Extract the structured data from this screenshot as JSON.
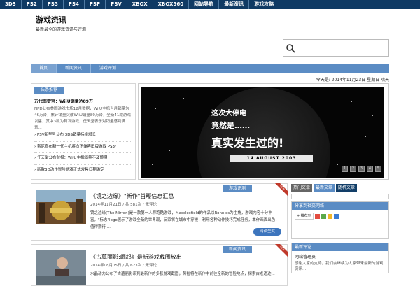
{
  "topnav": [
    "3DS",
    "PS2",
    "PS3",
    "PS4",
    "PSP",
    "PSV",
    "XBOX",
    "XBOX360",
    "网站导航",
    "最新资讯",
    "游戏攻略"
  ],
  "site": {
    "title": "游戏资讯",
    "description": "最新最全的游戏资讯与评测"
  },
  "search": {
    "placeholder": ""
  },
  "subnav": [
    "首页",
    "新闻资讯",
    "游戏评测"
  ],
  "date_line": "今天是: 2014年11月23日 星期日 晴天",
  "headline": {
    "tag": "头条推荐",
    "title": "万代南梦宫：WiiU销量达89万",
    "text": "NPD公布美国游戏市场12月数据，WiiU主机当月销量为46万台，累计销量突破WiiU销量89万台，全新41款游戏发售，其中3款为首发游戏，任天堂表示对销量感到满意..."
  },
  "headline_list": [
    "PSV新型号公布 3DS销量持续增长",
    "索尼宣布新一代主机将向下兼容旧版游戏 PS3/",
    "任天堂公布财报：WiiU主机销量不及预期",
    "新款3D动作冒险游戏正式发售日期确定"
  ],
  "slider": {
    "line1": "这次大停电",
    "line2": "竟然是……",
    "line3": "真实发生过的!",
    "date": "14 AUGUST 2003",
    "dots": [
      "1",
      "2",
      "3",
      "4",
      "5"
    ]
  },
  "posts": [
    {
      "tag": "游戏评测",
      "ribbon": "NEW",
      "title": "《镜之边缘》\"新作\"首曝信息汇总",
      "meta": "2014年11月21日 / 共 581次 / 无评论",
      "excerpt": "镜之边缘(The Mirror.)是一款第一人称跑酷游戏，Macclesfield的作品以Ronnies为主角，游戏内容十分丰富，\"标志\"logo展示了游戏全新的世界观，玩家将在城市中穿梭，利用各种动作技巧完成任务，本作画面出色，值得期待 ...",
      "read_more": "阅读全文"
    },
    {
      "tag": "新闻资讯",
      "ribbon": "NEW",
      "title": "《古墓丽影:崛起》最新游戏截图放出",
      "meta": "2014年08月05日 / 共 623次 / 无评论",
      "excerpt": "水晶动力公布了古墓丽影系列最新作的多张游戏截图，劳拉将在新作中前往全新的冒险地点，探索古老遗迹..."
    }
  ],
  "sidebar": {
    "tabs": [
      "热门文章",
      "最新文章",
      "随机文章"
    ],
    "share_title": "分享到社交网络",
    "share_button": "推荐到",
    "latest_title": "最新评论",
    "latest_item": "网站管理员",
    "latest_text": "感谢大家的支持，我们会继续为大家带来最新的游戏资讯..."
  },
  "colors": {
    "topnav": "#0f3a64",
    "accent": "#5b8cc4",
    "button": "#3d75bd",
    "ribbon": "#c0392b"
  }
}
